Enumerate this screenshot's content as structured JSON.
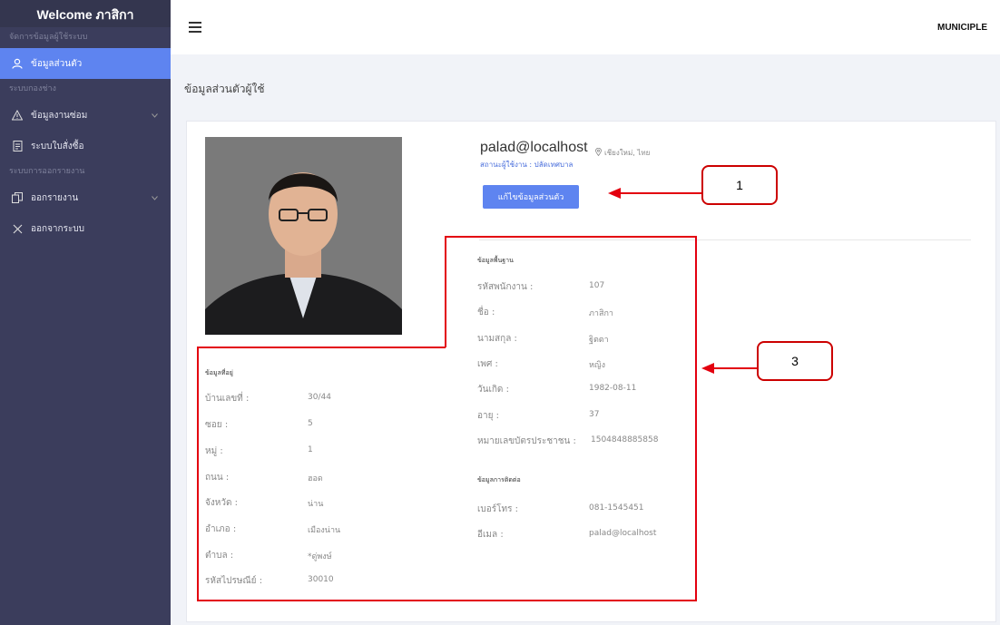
{
  "sidebar": {
    "brand": "Welcome ภาสิกา",
    "heading1": "จัดการข้อมูลผู้ใช้ระบบ",
    "item_profile": "ข้อมูลส่วนตัว",
    "heading2": "ระบบกองช่าง",
    "item_repair": "ข้อมูลงานซ่อม",
    "item_order": "ระบบใบสั่งซื้อ",
    "heading3": "ระบบการออกรายงาน",
    "item_report": "ออกรายงาน",
    "item_logout": "ออกจากระบบ"
  },
  "topbar": {
    "brand": "MUNICIPLE"
  },
  "page": {
    "title": "ข้อมูลส่วนตัวผู้ใช้"
  },
  "profile": {
    "email": "palad@localhost",
    "location": "เชียงใหม่, ไทย",
    "status": "สถานะผู้ใช้งาน : ปลัดเทศบาล",
    "edit_button": "แก้ไขข้อมูลส่วนตัว"
  },
  "basic": {
    "title": "ข้อมูลพื้นฐาน",
    "employee_id_label": "รหัสพนักงาน :",
    "employee_id": "107",
    "first_name_label": "ชื่อ :",
    "first_name": "ภาสิกา",
    "last_name_label": "นามสกุล :",
    "last_name": "ฐิตตา",
    "gender_label": "เพศ :",
    "gender": "หญิง",
    "birthdate_label": "วันเกิด :",
    "birthdate": "1982-08-11",
    "age_label": "อายุ :",
    "age": "37",
    "citizen_id_label": "หมายเลขบัตรประชาชน :",
    "citizen_id": "1504848885858"
  },
  "contact": {
    "title": "ข้อมูลการติดต่อ",
    "phone_label": "เบอร์โทร :",
    "phone": "081-1545451",
    "email_label": "อีเมล :",
    "email": "palad@localhost"
  },
  "address": {
    "title": "ข้อมูลที่อยู่",
    "house_no_label": "บ้านเลขที่ :",
    "house_no": "30/44",
    "soi_label": "ซอย :",
    "soi": "5",
    "moo_label": "หมู่ :",
    "moo": "1",
    "road_label": "ถนน :",
    "road": "ฮอด",
    "province_label": "จังหวัด :",
    "province": "น่าน",
    "district_label": "อำเภอ :",
    "district": "เมืองน่าน",
    "subdistrict_label": "ตำบล :",
    "subdistrict": "*ดู่พงษ์",
    "postcode_label": "รหัสไปรษณีย์ :",
    "postcode": "30010"
  },
  "annotations": {
    "callout1": "1",
    "callout3": "3"
  },
  "colors": {
    "sidebar": "#3b3d5c",
    "accent": "#5e84f0",
    "annotation": "#e3000f"
  }
}
